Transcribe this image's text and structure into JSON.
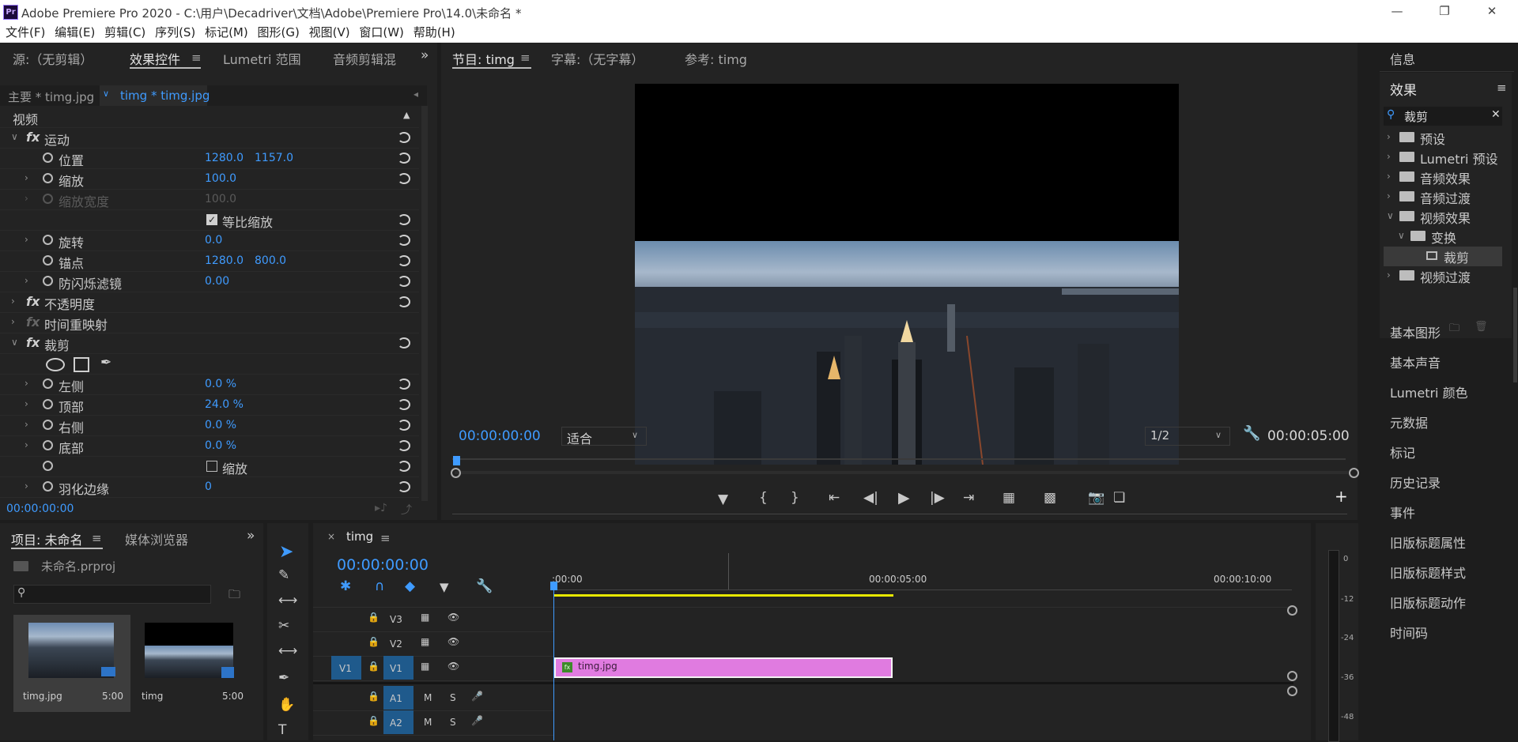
{
  "window": {
    "title": "Adobe Premiere Pro 2020 - C:\\用户\\Decadriver\\文档\\Adobe\\Premiere Pro\\14.0\\未命名 *",
    "app_badge": "Pr"
  },
  "menu": [
    "文件(F)",
    "编辑(E)",
    "剪辑(C)",
    "序列(S)",
    "标记(M)",
    "图形(G)",
    "视图(V)",
    "窗口(W)",
    "帮助(H)"
  ],
  "left_top": {
    "tabs": [
      "源:（无剪辑）",
      "效果控件",
      "Lumetri 范围",
      "音频剪辑混"
    ],
    "sub_tabs": [
      "主要 * timg.jpg",
      "timg * timg.jpg"
    ],
    "section_video": "视频",
    "motion": "运动",
    "position": {
      "label": "位置",
      "x": "1280.0",
      "y": "1157.0"
    },
    "scale": {
      "label": "缩放",
      "value": "100.0"
    },
    "scale_width": {
      "label": "缩放宽度",
      "value": "100.0"
    },
    "uniform_scale": "等比缩放",
    "rotation": {
      "label": "旋转",
      "value": "0.0"
    },
    "anchor": {
      "label": "锚点",
      "x": "1280.0",
      "y": "800.0"
    },
    "anti_flicker": {
      "label": "防闪烁滤镜",
      "value": "0.00"
    },
    "opacity": "不透明度",
    "time_remap": "时间重映射",
    "crop": "裁剪",
    "left": {
      "label": "左侧",
      "value": "0.0 %"
    },
    "top": {
      "label": "顶部",
      "value": "24.0 %"
    },
    "right": {
      "label": "右侧",
      "value": "0.0 %"
    },
    "bottom": {
      "label": "底部",
      "value": "0.0 %"
    },
    "zoom": "缩放",
    "feather": {
      "label": "羽化边缘",
      "value": "0"
    },
    "timecode": "00:00:00:00"
  },
  "program": {
    "tabs": [
      "节目: timg",
      "字幕:（无字幕）",
      "参考: timg"
    ],
    "timecode": "00:00:00:00",
    "fit": "适合",
    "resolution": "1/2",
    "duration": "00:00:05:00"
  },
  "project": {
    "tabs": [
      "项目: 未命名",
      "媒体浏览器"
    ],
    "file": "未命名.prproj",
    "items": [
      {
        "name": "timg.jpg",
        "dur": "5:00"
      },
      {
        "name": "timg",
        "dur": "5:00"
      }
    ]
  },
  "timeline": {
    "tab": "timg",
    "timecode": "00:00:00:00",
    "ruler": [
      ":00:00",
      "00:00:05:00",
      "00:00:10:00"
    ],
    "tracks_video": [
      "V3",
      "V2",
      "V1"
    ],
    "tracks_audio": [
      "A1",
      "A2"
    ],
    "source_patch": "V1",
    "clip": "timg.jpg",
    "m": "M",
    "s": "S"
  },
  "meter": {
    "labels": [
      "0",
      "-12",
      "-24",
      "-36",
      "-48"
    ]
  },
  "right_panel": {
    "info": "信息",
    "effects_title": "效果",
    "search_value": "裁剪",
    "tree": [
      "预设",
      "Lumetri 预设",
      "音频效果",
      "音频过渡",
      "视频效果",
      "变换",
      "裁剪",
      "视频过渡"
    ],
    "items": [
      "基本图形",
      "基本声音",
      "Lumetri 颜色",
      "元数据",
      "标记",
      "历史记录",
      "事件",
      "旧版标题属性",
      "旧版标题样式",
      "旧版标题动作",
      "时间码"
    ]
  },
  "colors": {
    "accent": "#3f9bff",
    "clip": "#e07be0",
    "work_area": "#e8e800",
    "selection": "#2d8ceb"
  }
}
